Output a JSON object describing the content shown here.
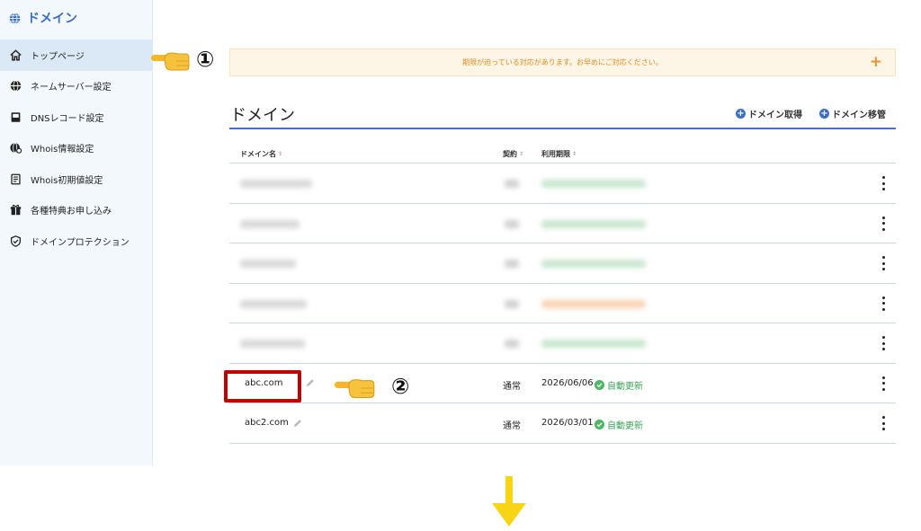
{
  "sidebar": {
    "title": "ドメイン",
    "items": [
      {
        "label": "トップページ",
        "icon": "home-icon"
      },
      {
        "label": "ネームサーバー設定",
        "icon": "globe-icon"
      },
      {
        "label": "DNSレコード設定",
        "icon": "book-icon"
      },
      {
        "label": "Whois情報設定",
        "icon": "globe-gear-icon"
      },
      {
        "label": "Whois初期値設定",
        "icon": "document-icon"
      },
      {
        "label": "各種特典お申し込み",
        "icon": "gift-icon"
      },
      {
        "label": "ドメインプロテクション",
        "icon": "shield-icon"
      }
    ]
  },
  "annotations": {
    "marker1": "①",
    "marker2": "②",
    "pointer_icon": "pointing-hand-icon"
  },
  "alert": {
    "message": "期限が迫っている対応があります。お早めにご対応ください。",
    "action": "+"
  },
  "main": {
    "title": "ドメイン",
    "actions": {
      "acquire": "ドメイン取得",
      "transfer": "ドメイン移管"
    }
  },
  "table": {
    "headers": {
      "domain": "ドメイン名",
      "contract": "契約",
      "expiry": "利用期限"
    },
    "rows": [
      {
        "domain": "abc.com",
        "contract": "通常",
        "expiry": "2026/06/06",
        "status": "自動更新"
      },
      {
        "domain": "abc2.com",
        "contract": "通常",
        "expiry": "2026/03/01",
        "status": "自動更新"
      }
    ]
  },
  "colors": {
    "accent": "#3a6fc4",
    "alert_text": "#e08a1e",
    "status_ok": "#4cb866",
    "highlight": "#c00000",
    "arrow": "#f7d414"
  }
}
